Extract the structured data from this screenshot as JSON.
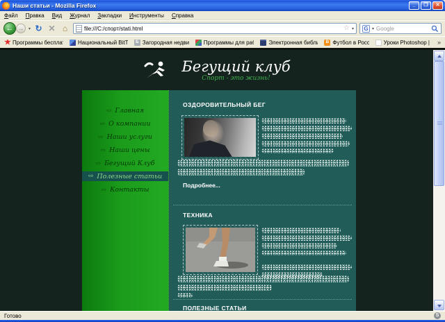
{
  "window": {
    "title": "Наши статьи - Mozilla Firefox",
    "minimize_glyph": "_",
    "restore_glyph": "❐",
    "close_glyph": "✕"
  },
  "menu_bar": {
    "items": [
      "Файл",
      "Правка",
      "Вид",
      "Журнал",
      "Закладки",
      "Инструменты",
      "Справка"
    ]
  },
  "navigation_toolbar": {
    "back_glyph": "←",
    "forward_glyph": "→",
    "refresh_glyph": "↻",
    "stop_glyph": "✕",
    "home_glyph": "⌂",
    "url": "file:///C:/спорт/stati.html",
    "star_glyph": "☆",
    "search_engine_glyph": "G",
    "search_placeholder": "Google"
  },
  "bookmarks_bar": {
    "items": [
      {
        "label": "Программы бесплатн...",
        "icon": "red-star"
      },
      {
        "label": "Национальный BitTor...",
        "icon": "bittorrent"
      },
      {
        "label": "Загородная недвиж...",
        "icon": "letter-grey",
        "glyph": "Б"
      },
      {
        "label": "Программы для рабо...",
        "icon": "multicolor"
      },
      {
        "label": "Электронная библио...",
        "icon": "book"
      },
      {
        "label": "Футбол в России",
        "icon": "blogger",
        "glyph": "B"
      },
      {
        "label": "Уроки Photoshop | С...",
        "icon": "blank"
      }
    ],
    "overflow_glyph": "»"
  },
  "site": {
    "title": "Бегущий клуб",
    "tagline": "Спорт - это жизнь!",
    "nav_arrow": "⇨",
    "nav": [
      {
        "label": "Главная"
      },
      {
        "label": "О компании"
      },
      {
        "label": "Наши услуги"
      },
      {
        "label": "Наши цены"
      },
      {
        "label": "Бегущий Клуб"
      },
      {
        "label": "Полезные статьи",
        "active": true
      },
      {
        "label": "Контакты"
      }
    ],
    "sections": [
      {
        "heading": "ОЗДОРОВИТЕЛЬНЫЙ БЕГ",
        "image": "woman-athlete-photo",
        "more_label": "Подробнее..."
      },
      {
        "heading": "ТЕХНИКА",
        "image": "runner-legs-photo"
      },
      {
        "heading": "ПОЛЕЗНЫЕ СТАТЬИ"
      }
    ]
  },
  "status_bar": {
    "text": "Готово",
    "extension_glyph": "S"
  },
  "colors": {
    "sidebar_green": "#1b9c1b",
    "content_teal": "#215c58",
    "page_dark": "#15231e",
    "tagline_green": "#3fae4e",
    "active_item_bg": "#17514d",
    "active_item_text": "#8ed487",
    "titlebar_blue": "#2760dd",
    "chrome_beige": "#ece9d8"
  }
}
